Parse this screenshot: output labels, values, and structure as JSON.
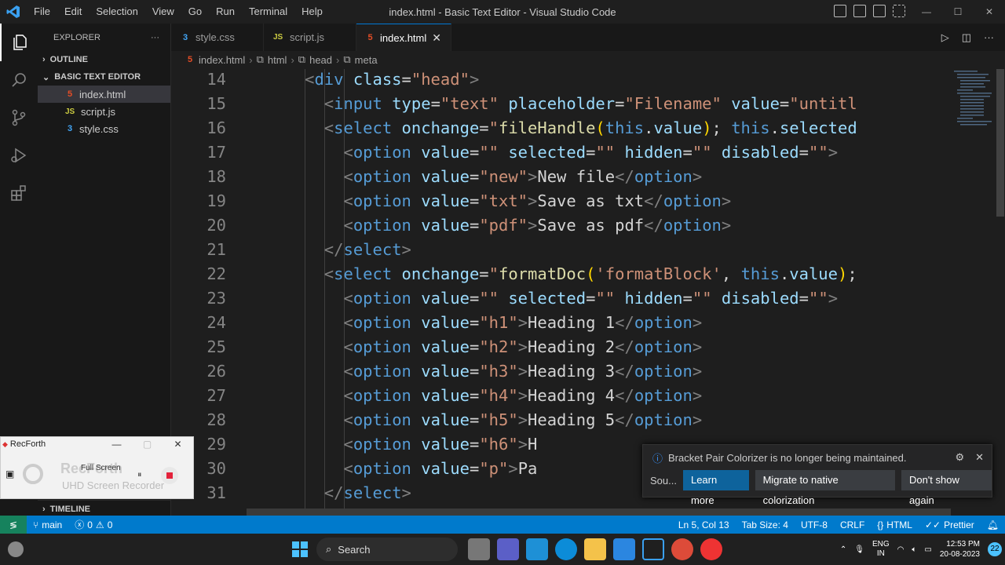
{
  "window": {
    "title": "index.html - Basic Text Editor - Visual Studio Code",
    "menu": [
      "File",
      "Edit",
      "Selection",
      "View",
      "Go",
      "Run",
      "Terminal",
      "Help"
    ],
    "controls": [
      "—",
      "☐",
      "✕"
    ]
  },
  "activity_bar": [
    "explorer-icon",
    "search-icon",
    "source-control-icon",
    "run-debug-icon",
    "extensions-icon",
    "account-icon",
    "settings-icon"
  ],
  "sidebar": {
    "header": "EXPLORER",
    "more": "···",
    "outline": "OUTLINE",
    "project": "BASIC TEXT EDITOR",
    "files": [
      {
        "name": "index.html",
        "type": "html",
        "badge": "5"
      },
      {
        "name": "script.js",
        "type": "js",
        "badge": "JS"
      },
      {
        "name": "style.css",
        "type": "css",
        "badge": "3"
      }
    ],
    "timeline": "TIMELINE"
  },
  "tabs": [
    {
      "label": "style.css",
      "type": "css",
      "badge": "3"
    },
    {
      "label": "script.js",
      "type": "js",
      "badge": "JS"
    },
    {
      "label": "index.html",
      "type": "html",
      "badge": "5",
      "active": true,
      "close": "✕"
    }
  ],
  "breadcrumb": {
    "file": "index.html",
    "items": [
      "html",
      "head",
      "meta"
    ],
    "sep": "›"
  },
  "editor": {
    "lines": [
      {
        "n": "14",
        "indent": 6,
        "tokens": [
          [
            "br",
            "<"
          ],
          [
            "tg",
            "div"
          ],
          [
            "tx",
            " "
          ],
          [
            "at",
            "class"
          ],
          [
            "tx",
            "="
          ],
          [
            "st",
            "\"head\""
          ],
          [
            "br",
            ">"
          ]
        ]
      },
      {
        "n": "15",
        "indent": 8,
        "tokens": [
          [
            "br",
            "<"
          ],
          [
            "tg",
            "input"
          ],
          [
            "tx",
            " "
          ],
          [
            "at",
            "type"
          ],
          [
            "tx",
            "="
          ],
          [
            "st",
            "\"text\""
          ],
          [
            "tx",
            " "
          ],
          [
            "at",
            "placeholder"
          ],
          [
            "tx",
            "="
          ],
          [
            "st",
            "\"Filename\""
          ],
          [
            "tx",
            " "
          ],
          [
            "at",
            "value"
          ],
          [
            "tx",
            "="
          ],
          [
            "st",
            "\"untitl"
          ]
        ]
      },
      {
        "n": "16",
        "indent": 8,
        "tokens": [
          [
            "br",
            "<"
          ],
          [
            "tg",
            "select"
          ],
          [
            "tx",
            " "
          ],
          [
            "at",
            "onchange"
          ],
          [
            "tx",
            "="
          ],
          [
            "st",
            "\""
          ],
          [
            "fn",
            "fileHandle"
          ],
          [
            "pn",
            "("
          ],
          [
            "kw",
            "this"
          ],
          [
            "tx",
            "."
          ],
          [
            "at",
            "value"
          ],
          [
            "pn",
            ")"
          ],
          [
            "tx",
            "; "
          ],
          [
            "kw",
            "this"
          ],
          [
            "tx",
            "."
          ],
          [
            "at",
            "selected"
          ]
        ]
      },
      {
        "n": "17",
        "indent": 10,
        "tokens": [
          [
            "br",
            "<"
          ],
          [
            "tg",
            "option"
          ],
          [
            "tx",
            " "
          ],
          [
            "at",
            "value"
          ],
          [
            "tx",
            "="
          ],
          [
            "st",
            "\"\""
          ],
          [
            "tx",
            " "
          ],
          [
            "at",
            "selected"
          ],
          [
            "tx",
            "="
          ],
          [
            "st",
            "\"\""
          ],
          [
            "tx",
            " "
          ],
          [
            "at",
            "hidden"
          ],
          [
            "tx",
            "="
          ],
          [
            "st",
            "\"\""
          ],
          [
            "tx",
            " "
          ],
          [
            "at",
            "disabled"
          ],
          [
            "tx",
            "="
          ],
          [
            "st",
            "\"\""
          ],
          [
            "br",
            ">"
          ]
        ]
      },
      {
        "n": "18",
        "indent": 10,
        "tokens": [
          [
            "br",
            "<"
          ],
          [
            "tg",
            "option"
          ],
          [
            "tx",
            " "
          ],
          [
            "at",
            "value"
          ],
          [
            "tx",
            "="
          ],
          [
            "st",
            "\"new\""
          ],
          [
            "br",
            ">"
          ],
          [
            "tx",
            "New file"
          ],
          [
            "br",
            "</"
          ],
          [
            "tg",
            "option"
          ],
          [
            "br",
            ">"
          ]
        ]
      },
      {
        "n": "19",
        "indent": 10,
        "tokens": [
          [
            "br",
            "<"
          ],
          [
            "tg",
            "option"
          ],
          [
            "tx",
            " "
          ],
          [
            "at",
            "value"
          ],
          [
            "tx",
            "="
          ],
          [
            "st",
            "\"txt\""
          ],
          [
            "br",
            ">"
          ],
          [
            "tx",
            "Save as txt"
          ],
          [
            "br",
            "</"
          ],
          [
            "tg",
            "option"
          ],
          [
            "br",
            ">"
          ]
        ]
      },
      {
        "n": "20",
        "indent": 10,
        "tokens": [
          [
            "br",
            "<"
          ],
          [
            "tg",
            "option"
          ],
          [
            "tx",
            " "
          ],
          [
            "at",
            "value"
          ],
          [
            "tx",
            "="
          ],
          [
            "st",
            "\"pdf\""
          ],
          [
            "br",
            ">"
          ],
          [
            "tx",
            "Save as pdf"
          ],
          [
            "br",
            "</"
          ],
          [
            "tg",
            "option"
          ],
          [
            "br",
            ">"
          ]
        ]
      },
      {
        "n": "21",
        "indent": 8,
        "tokens": [
          [
            "br",
            "</"
          ],
          [
            "tg",
            "select"
          ],
          [
            "br",
            ">"
          ]
        ]
      },
      {
        "n": "22",
        "indent": 8,
        "tokens": [
          [
            "br",
            "<"
          ],
          [
            "tg",
            "select"
          ],
          [
            "tx",
            " "
          ],
          [
            "at",
            "onchange"
          ],
          [
            "tx",
            "="
          ],
          [
            "st",
            "\""
          ],
          [
            "fn",
            "formatDoc"
          ],
          [
            "pn",
            "("
          ],
          [
            "st",
            "'formatBlock'"
          ],
          [
            "tx",
            ", "
          ],
          [
            "kw",
            "this"
          ],
          [
            "tx",
            "."
          ],
          [
            "at",
            "value"
          ],
          [
            "pn",
            ")"
          ],
          [
            "tx",
            ";"
          ]
        ]
      },
      {
        "n": "23",
        "indent": 10,
        "tokens": [
          [
            "br",
            "<"
          ],
          [
            "tg",
            "option"
          ],
          [
            "tx",
            " "
          ],
          [
            "at",
            "value"
          ],
          [
            "tx",
            "="
          ],
          [
            "st",
            "\"\""
          ],
          [
            "tx",
            " "
          ],
          [
            "at",
            "selected"
          ],
          [
            "tx",
            "="
          ],
          [
            "st",
            "\"\""
          ],
          [
            "tx",
            " "
          ],
          [
            "at",
            "hidden"
          ],
          [
            "tx",
            "="
          ],
          [
            "st",
            "\"\""
          ],
          [
            "tx",
            " "
          ],
          [
            "at",
            "disabled"
          ],
          [
            "tx",
            "="
          ],
          [
            "st",
            "\"\""
          ],
          [
            "br",
            ">"
          ]
        ]
      },
      {
        "n": "24",
        "indent": 10,
        "tokens": [
          [
            "br",
            "<"
          ],
          [
            "tg",
            "option"
          ],
          [
            "tx",
            " "
          ],
          [
            "at",
            "value"
          ],
          [
            "tx",
            "="
          ],
          [
            "st",
            "\"h1\""
          ],
          [
            "br",
            ">"
          ],
          [
            "tx",
            "Heading 1"
          ],
          [
            "br",
            "</"
          ],
          [
            "tg",
            "option"
          ],
          [
            "br",
            ">"
          ]
        ]
      },
      {
        "n": "25",
        "indent": 10,
        "tokens": [
          [
            "br",
            "<"
          ],
          [
            "tg",
            "option"
          ],
          [
            "tx",
            " "
          ],
          [
            "at",
            "value"
          ],
          [
            "tx",
            "="
          ],
          [
            "st",
            "\"h2\""
          ],
          [
            "br",
            ">"
          ],
          [
            "tx",
            "Heading 2"
          ],
          [
            "br",
            "</"
          ],
          [
            "tg",
            "option"
          ],
          [
            "br",
            ">"
          ]
        ]
      },
      {
        "n": "26",
        "indent": 10,
        "tokens": [
          [
            "br",
            "<"
          ],
          [
            "tg",
            "option"
          ],
          [
            "tx",
            " "
          ],
          [
            "at",
            "value"
          ],
          [
            "tx",
            "="
          ],
          [
            "st",
            "\"h3\""
          ],
          [
            "br",
            ">"
          ],
          [
            "tx",
            "Heading 3"
          ],
          [
            "br",
            "</"
          ],
          [
            "tg",
            "option"
          ],
          [
            "br",
            ">"
          ]
        ]
      },
      {
        "n": "27",
        "indent": 10,
        "tokens": [
          [
            "br",
            "<"
          ],
          [
            "tg",
            "option"
          ],
          [
            "tx",
            " "
          ],
          [
            "at",
            "value"
          ],
          [
            "tx",
            "="
          ],
          [
            "st",
            "\"h4\""
          ],
          [
            "br",
            ">"
          ],
          [
            "tx",
            "Heading 4"
          ],
          [
            "br",
            "</"
          ],
          [
            "tg",
            "option"
          ],
          [
            "br",
            ">"
          ]
        ]
      },
      {
        "n": "28",
        "indent": 10,
        "tokens": [
          [
            "br",
            "<"
          ],
          [
            "tg",
            "option"
          ],
          [
            "tx",
            " "
          ],
          [
            "at",
            "value"
          ],
          [
            "tx",
            "="
          ],
          [
            "st",
            "\"h5\""
          ],
          [
            "br",
            ">"
          ],
          [
            "tx",
            "Heading 5"
          ],
          [
            "br",
            "</"
          ],
          [
            "tg",
            "option"
          ],
          [
            "br",
            ">"
          ]
        ]
      },
      {
        "n": "29",
        "indent": 10,
        "tokens": [
          [
            "br",
            "<"
          ],
          [
            "tg",
            "option"
          ],
          [
            "tx",
            " "
          ],
          [
            "at",
            "value"
          ],
          [
            "tx",
            "="
          ],
          [
            "st",
            "\"h6\""
          ],
          [
            "br",
            ">"
          ],
          [
            "tx",
            "H"
          ]
        ]
      },
      {
        "n": "30",
        "indent": 10,
        "tokens": [
          [
            "br",
            "<"
          ],
          [
            "tg",
            "option"
          ],
          [
            "tx",
            " "
          ],
          [
            "at",
            "value"
          ],
          [
            "tx",
            "="
          ],
          [
            "st",
            "\"p\""
          ],
          [
            "br",
            ">"
          ],
          [
            "tx",
            "Pa"
          ]
        ]
      },
      {
        "n": "31",
        "indent": 8,
        "tokens": [
          [
            "br",
            "</"
          ],
          [
            "tg",
            "select"
          ],
          [
            "br",
            ">"
          ]
        ]
      }
    ]
  },
  "notification": {
    "message": "Bracket Pair Colorizer is no longer being maintained.",
    "source": "Sou...",
    "buttons": [
      "Learn more",
      "Migrate to native colorization",
      "Don't show again"
    ]
  },
  "recorder": {
    "app": "RecForth",
    "watermark": "RecForth",
    "sub": "UHD Screen Recorder",
    "mode": "Full Screen"
  },
  "statusbar": {
    "branch": "main",
    "errors": "0",
    "warnings": "0",
    "position": "Ln 5, Col 13",
    "tab_size": "Tab Size: 4",
    "encoding": "UTF-8",
    "eol": "CRLF",
    "language": "HTML",
    "formatter": "Prettier"
  },
  "taskbar": {
    "search": "Search",
    "lang": "ENG",
    "region": "IN",
    "time": "12:53 PM",
    "date": "20-08-2023",
    "notif_count": "22"
  },
  "colors": {
    "accent": "#007acc",
    "editor_bg": "#1e1e1e",
    "sidebar_bg": "#181818"
  }
}
